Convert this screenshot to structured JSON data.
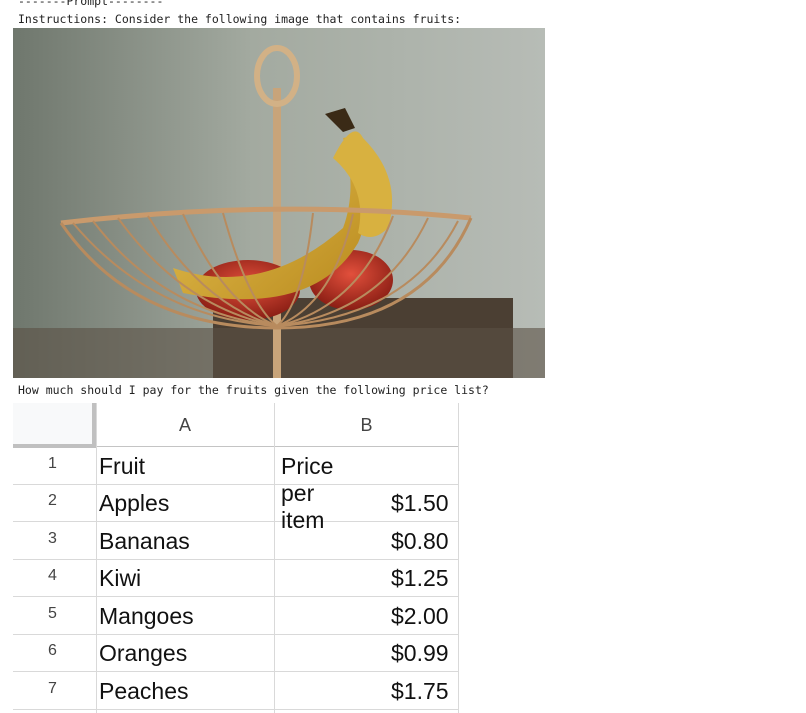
{
  "prompt_header": "-------Prompt--------",
  "instructions": "Instructions: Consider the following image that contains fruits:",
  "question": "How much should I pay for the fruits given the following price list?",
  "spreadsheet": {
    "columns": [
      "A",
      "B"
    ],
    "rows": [
      {
        "num": "1",
        "a": "Fruit",
        "b": "Price per item"
      },
      {
        "num": "2",
        "a": "Apples",
        "b": "$1.50"
      },
      {
        "num": "3",
        "a": "Bananas",
        "b": "$0.80"
      },
      {
        "num": "4",
        "a": "Kiwi",
        "b": "$1.25"
      },
      {
        "num": "5",
        "a": "Mangoes",
        "b": "$2.00"
      },
      {
        "num": "6",
        "a": "Oranges",
        "b": "$0.99"
      },
      {
        "num": "7",
        "a": "Peaches",
        "b": "$1.75"
      }
    ]
  }
}
